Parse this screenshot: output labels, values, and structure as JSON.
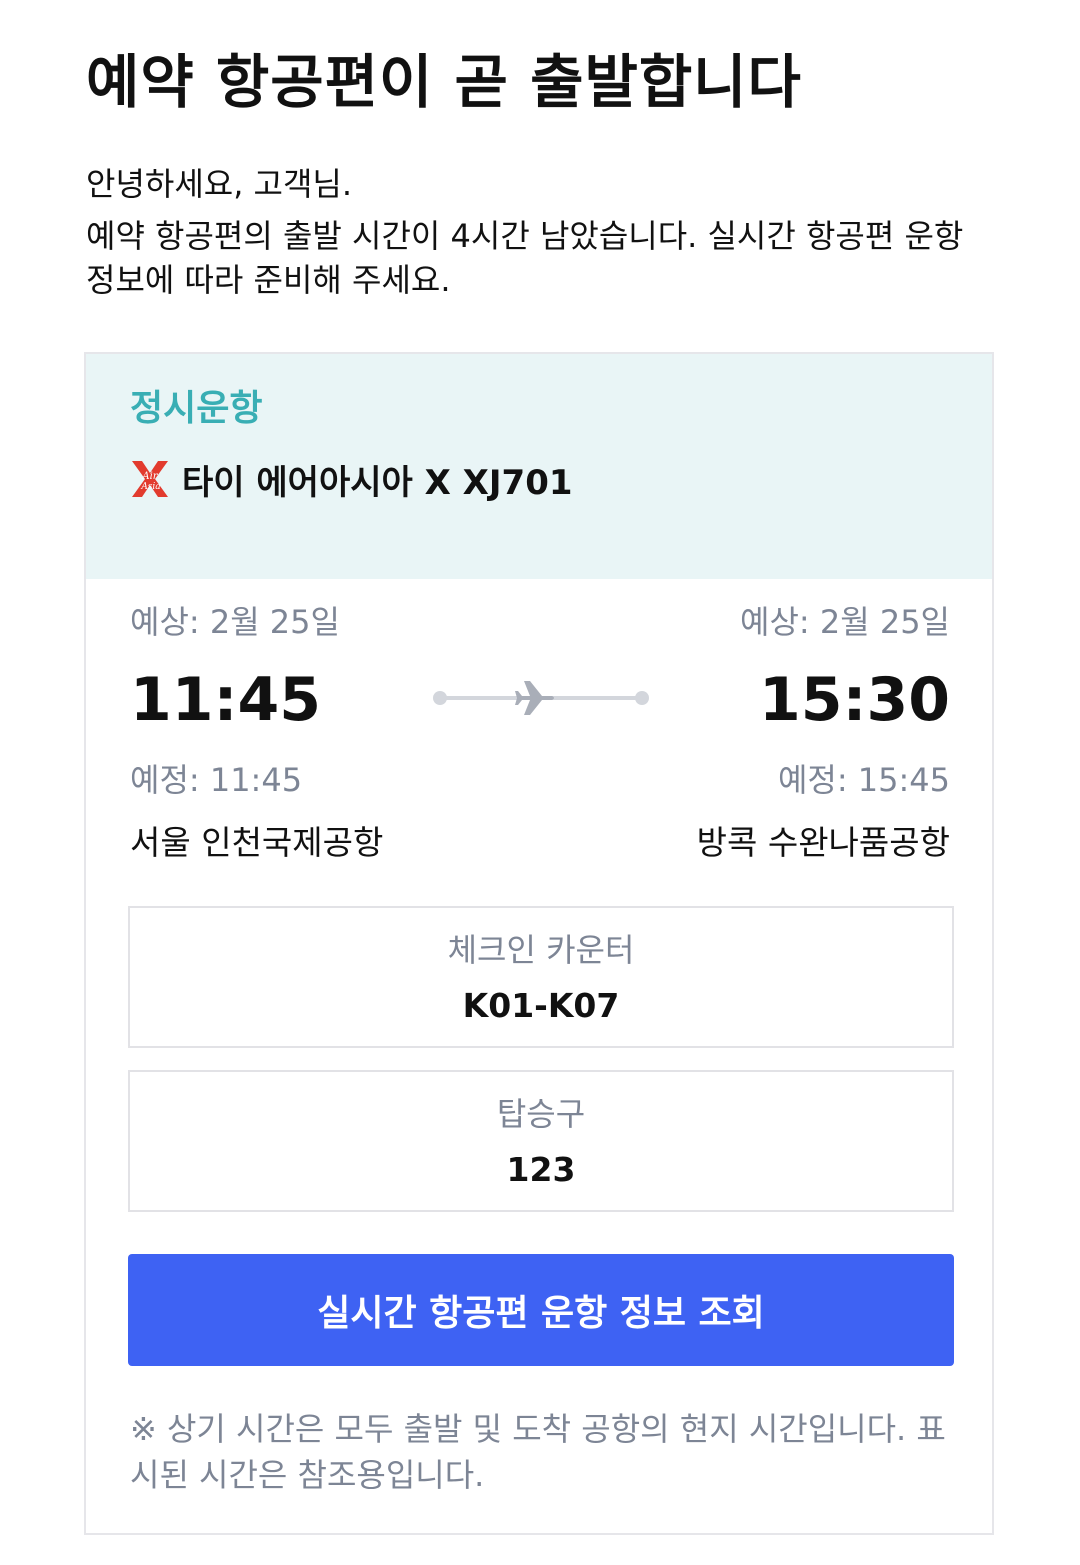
{
  "title": "예약 항공편이 곧 출발합니다",
  "greeting": "안녕하세요, 고객님.",
  "intro": "예약 항공편의 출발 시간이 4시간 남았습니다. 실시간 항공편 운항 정보에 따라 준비해 주세요.",
  "flight": {
    "status": "정시운항",
    "status_color": "#39aeb4",
    "airline_logo": "airasia-x-logo",
    "airline": "타이 에어아시아 X XJ701",
    "departure": {
      "estimated_date": "예상: 2월 25일",
      "time": "11:45",
      "scheduled": "예정: 11:45",
      "airport": "서울 인천국제공항"
    },
    "arrival": {
      "estimated_date": "예상: 2월 25일",
      "time": "15:30",
      "scheduled": "예정: 15:45",
      "airport": "방콕 수완나품공항"
    },
    "route_icon": "airplane-icon"
  },
  "checkin": {
    "label": "체크인 카운터",
    "value": "K01-K07"
  },
  "gate": {
    "label": "탑승구",
    "value": "123"
  },
  "cta": {
    "label": "실시간 항공편 운항 정보 조회",
    "color": "#3e62f3"
  },
  "footnote": "※ 상기 시간은 모두 출발 및 도착 공항의 현지 시간입니다. 표시된 시간은 참조용입니다."
}
